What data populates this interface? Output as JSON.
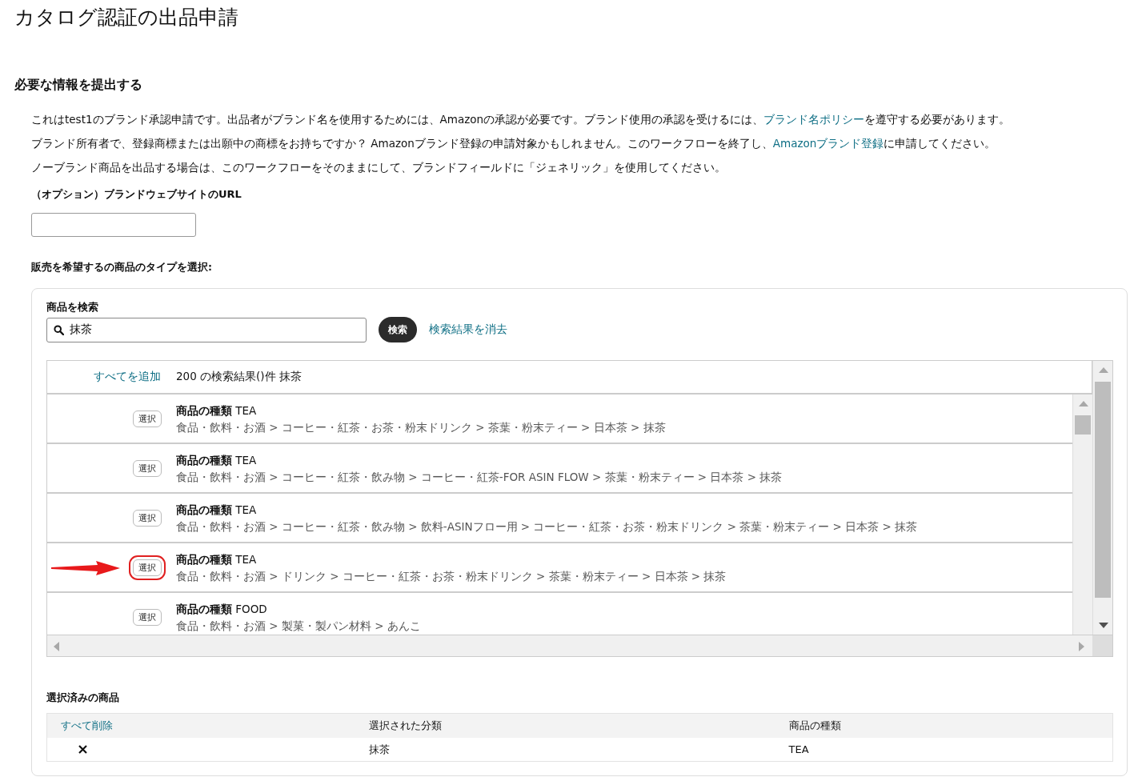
{
  "page_title": "カタログ認証の出品申請",
  "section_heading": "必要な情報を提出する",
  "paragraphs": [
    {
      "parts": [
        {
          "text": "これはtest1のブランド承認申請です。出品者がブランド名を使用するためには、Amazonの承認が必要です。ブランド使用の承認を受けるには、",
          "link": false
        },
        {
          "text": "ブランド名ポリシー",
          "link": true
        },
        {
          "text": "を遵守する必要があります。",
          "link": false
        }
      ]
    },
    {
      "parts": [
        {
          "text": "ブランド所有者で、登録商標または出願中の商標をお持ちですか？ Amazonブランド登録の申請対象かもしれません。このワークフローを終了し、",
          "link": false
        },
        {
          "text": "Amazonブランド登録",
          "link": true
        },
        {
          "text": "に申請してください。",
          "link": false
        }
      ]
    },
    {
      "parts": [
        {
          "text": "ノーブランド商品を出品する場合は、このワークフローをそのままにして、ブランドフィールドに「ジェネリック」を使用してください。",
          "link": false
        }
      ]
    }
  ],
  "url_field": {
    "label": "（オプション）ブランドウェブサイトのURL"
  },
  "type_label": "販売を希望するの商品のタイプを選択:",
  "search": {
    "label": "商品を検索",
    "value": "抹茶",
    "button": "検索",
    "clear_link": "検索結果を消去"
  },
  "results": {
    "add_all": "すべてを追加",
    "summary": "200 の検索結果()件 抹茶",
    "rows": [
      {
        "button": "選択",
        "type_label": "商品の種類",
        "type_value": "TEA",
        "path": "食品・飲料・お酒 > コーヒー・紅茶・お茶・粉末ドリンク > 茶葉・粉末ティー > 日本茶 > 抹茶",
        "highlighted": false
      },
      {
        "button": "選択",
        "type_label": "商品の種類",
        "type_value": "TEA",
        "path": "食品・飲料・お酒 > コーヒー・紅茶・飲み物 > コーヒー・紅茶-FOR ASIN FLOW > 茶葉・粉末ティー > 日本茶 > 抹茶",
        "highlighted": false
      },
      {
        "button": "選択",
        "type_label": "商品の種類",
        "type_value": "TEA",
        "path": "食品・飲料・お酒 > コーヒー・紅茶・飲み物 > 飲料-ASINフロー用 > コーヒー・紅茶・お茶・粉末ドリンク > 茶葉・粉末ティー > 日本茶 > 抹茶",
        "highlighted": false
      },
      {
        "button": "選択",
        "type_label": "商品の種類",
        "type_value": "TEA",
        "path": "食品・飲料・お酒 > ドリンク > コーヒー・紅茶・お茶・粉末ドリンク > 茶葉・粉末ティー > 日本茶 > 抹茶",
        "highlighted": true
      },
      {
        "button": "選択",
        "type_label": "商品の種類",
        "type_value": "FOOD",
        "path": "食品・飲料・お酒 > 製菓・製パン材料 > あんこ",
        "highlighted": false
      }
    ]
  },
  "selected_products": {
    "heading": "選択済みの商品",
    "remove_all": "すべて削除",
    "columns": [
      "選択された分類",
      "商品の種類"
    ],
    "rows": [
      {
        "cells": [
          "抹茶",
          "TEA"
        ]
      }
    ]
  }
}
